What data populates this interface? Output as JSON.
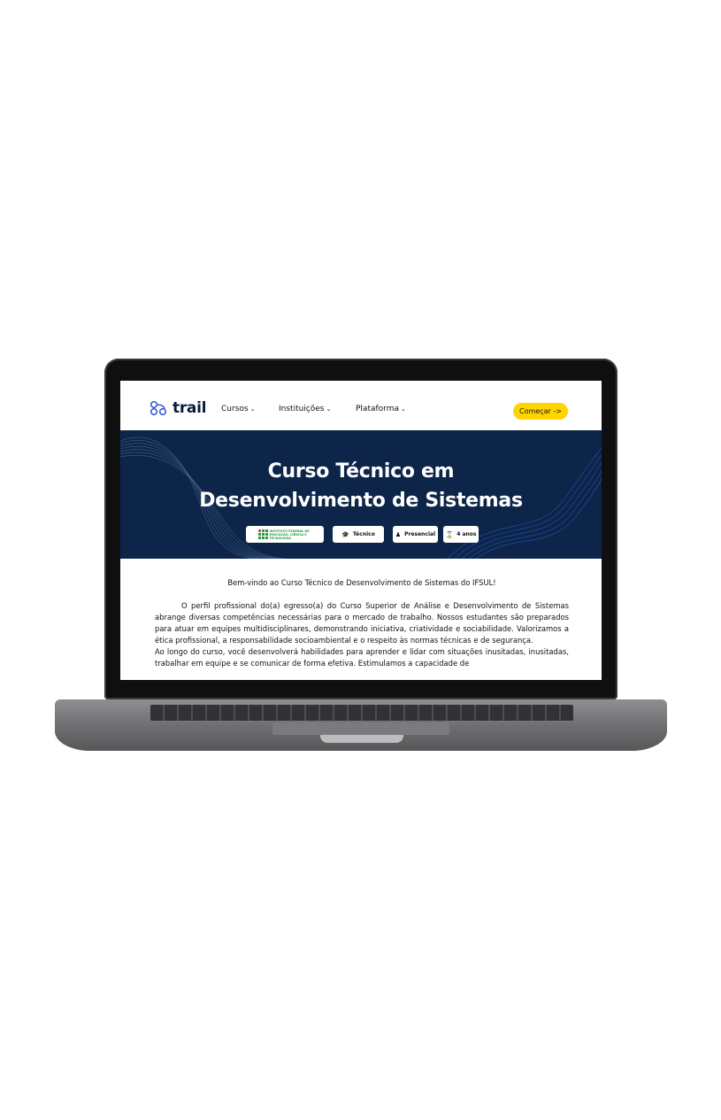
{
  "site": {
    "logo_text": "trail",
    "nav": [
      {
        "label": "Cursos"
      },
      {
        "label": "Instituições"
      },
      {
        "label": "Plataforma"
      }
    ],
    "cta_label": "Começar ->"
  },
  "hero": {
    "title_line1": "Curso Técnico em",
    "title_line2": "Desenvolvimento de Sistemas",
    "institution_text": "INSTITUTO FEDERAL DE EDUCAÇÃO, CIÊNCIA E TECNOLOGIA",
    "tags": [
      {
        "icon": "graduation-cap-icon",
        "label": "Técnico"
      },
      {
        "icon": "person-icon",
        "label": "Presencial"
      },
      {
        "icon": "hourglass-icon",
        "label": "4 anos"
      }
    ]
  },
  "content": {
    "welcome": "Bem-vindo ao Curso  Técnico de Desenvolvimento de Sistemas do IFSUL!",
    "paragraph1": "O perfil profissional do(a) egresso(a) do Curso Superior de Análise e Desenvolvimento de Sistemas abrange diversas competências necessárias para o mercado de trabalho. Nossos estudantes são preparados para atuar em equipes multidisciplinares, demonstrando iniciativa, criatividade e sociabilidade. Valorizamos a ética profissional, a responsabilidade socioambiental e o respeito às normas técnicas e de segurança.",
    "paragraph2": "Ao longo do curso, você desenvolverá habilidades para aprender e lidar com situações inusitadas, inusitadas, trabalhar em equipe e se comunicar de forma efetiva. Estimulamos a capacidade de"
  },
  "colors": {
    "hero_bg": "#0c2549",
    "cta_bg": "#ffd500",
    "logo_blue": "#3b5bdb"
  }
}
